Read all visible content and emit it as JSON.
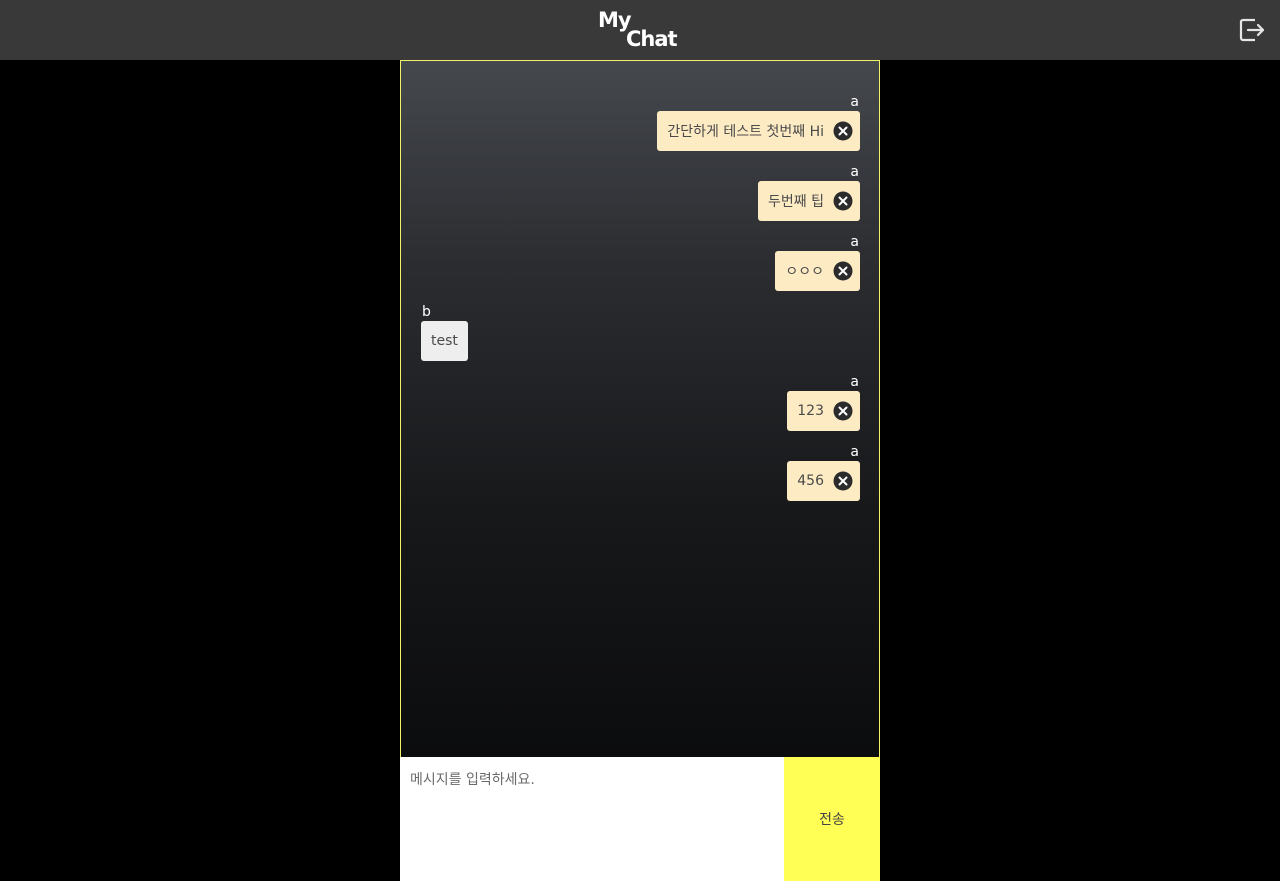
{
  "header": {
    "logo_line1": "My",
    "logo_line2": "Chat",
    "logout_icon": "logout-icon"
  },
  "messages": [
    {
      "sender": "a",
      "text": "간단하게 테스트 첫번째 Hi",
      "mine": true
    },
    {
      "sender": "a",
      "text": "두번째 팁",
      "mine": true
    },
    {
      "sender": "a",
      "text": "ㅇㅇㅇ",
      "mine": true
    },
    {
      "sender": "b",
      "text": "test",
      "mine": false
    },
    {
      "sender": "a",
      "text": "123",
      "mine": true
    },
    {
      "sender": "a",
      "text": "456",
      "mine": true
    }
  ],
  "composer": {
    "placeholder": "메시지를 입력하세요.",
    "send_label": "전송"
  },
  "colors": {
    "topbar": "#393939",
    "mine_bubble": "#fdebc4",
    "other_bubble": "#eeeeee",
    "send_button": "#ffff55",
    "chat_border": "#f3f06a"
  }
}
